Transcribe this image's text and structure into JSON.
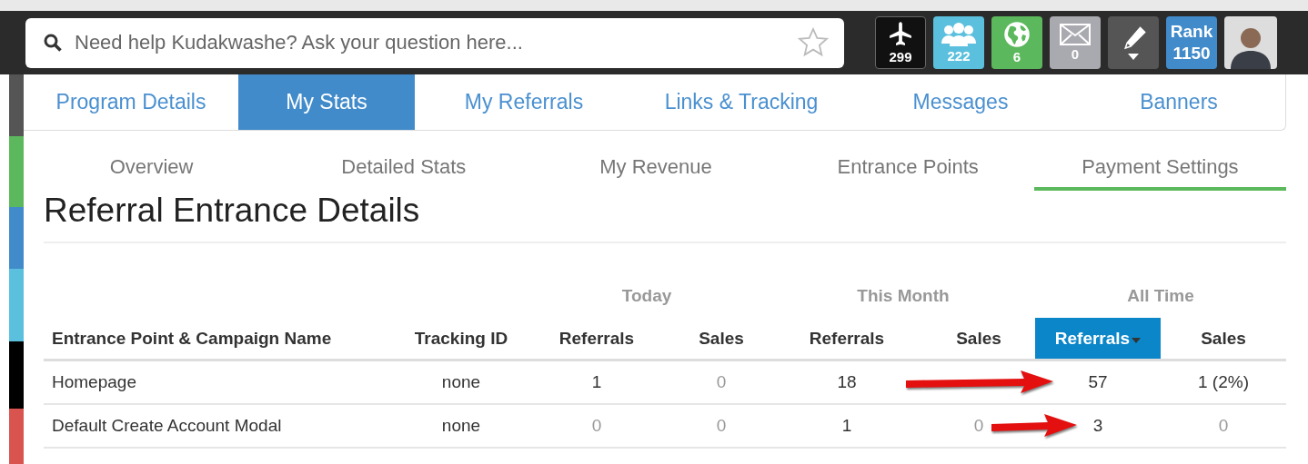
{
  "search": {
    "placeholder": "Need help Kudakwashe? Ask your question here..."
  },
  "badges": [
    {
      "kind": "plane",
      "count": "299",
      "color": "#111111"
    },
    {
      "kind": "people",
      "count": "222",
      "color": "#5bc0de"
    },
    {
      "kind": "globe",
      "count": "6",
      "color": "#5cb85c"
    },
    {
      "kind": "mail",
      "count": "0",
      "color": "#a9a9b0"
    },
    {
      "kind": "pen",
      "color": "#555555"
    },
    {
      "kind": "rank",
      "label": "Rank",
      "count": "1150",
      "color": "#428bca"
    },
    {
      "kind": "avatar"
    }
  ],
  "tabs": [
    {
      "label": "Program Details",
      "selected": false
    },
    {
      "label": "My Stats",
      "selected": true
    },
    {
      "label": "My Referrals",
      "selected": false
    },
    {
      "label": "Links & Tracking",
      "selected": false
    },
    {
      "label": "Messages",
      "selected": false
    },
    {
      "label": "Banners",
      "selected": false
    }
  ],
  "sub_tabs": [
    {
      "label": "Overview",
      "selected": false
    },
    {
      "label": "Detailed Stats",
      "selected": false
    },
    {
      "label": "My Revenue",
      "selected": false
    },
    {
      "label": "Entrance Points",
      "selected": false
    },
    {
      "label": "Payment Settings",
      "selected": true
    }
  ],
  "heading": "Referral Entrance Details",
  "table": {
    "groups": [
      "Today",
      "This Month",
      "All Time"
    ],
    "columns": [
      {
        "label": "Entrance Point & Campaign Name",
        "sorted": false
      },
      {
        "label": "Tracking ID",
        "sorted": false
      },
      {
        "label": "Referrals",
        "sorted": false
      },
      {
        "label": "Sales",
        "sorted": false
      },
      {
        "label": "Referrals",
        "sorted": false
      },
      {
        "label": "Sales",
        "sorted": false
      },
      {
        "label": "Referrals",
        "sorted": true
      },
      {
        "label": "Sales",
        "sorted": false
      }
    ],
    "rows": [
      {
        "cells": [
          {
            "text": "Homepage",
            "muted": false
          },
          {
            "text": "none",
            "muted": false
          },
          {
            "text": "1",
            "muted": false
          },
          {
            "text": "0",
            "muted": true
          },
          {
            "text": "18",
            "muted": false
          },
          null,
          {
            "text": "57",
            "muted": false
          },
          {
            "text": "1 (2%)",
            "muted": false
          }
        ]
      },
      {
        "cells": [
          {
            "text": "Default Create Account Modal",
            "muted": false
          },
          {
            "text": "none",
            "muted": false
          },
          {
            "text": "0",
            "muted": true
          },
          {
            "text": "0",
            "muted": true
          },
          {
            "text": "1",
            "muted": false
          },
          {
            "text": "0",
            "muted": true
          },
          {
            "text": "3",
            "muted": false
          },
          {
            "text": "0",
            "muted": true
          }
        ]
      }
    ]
  }
}
